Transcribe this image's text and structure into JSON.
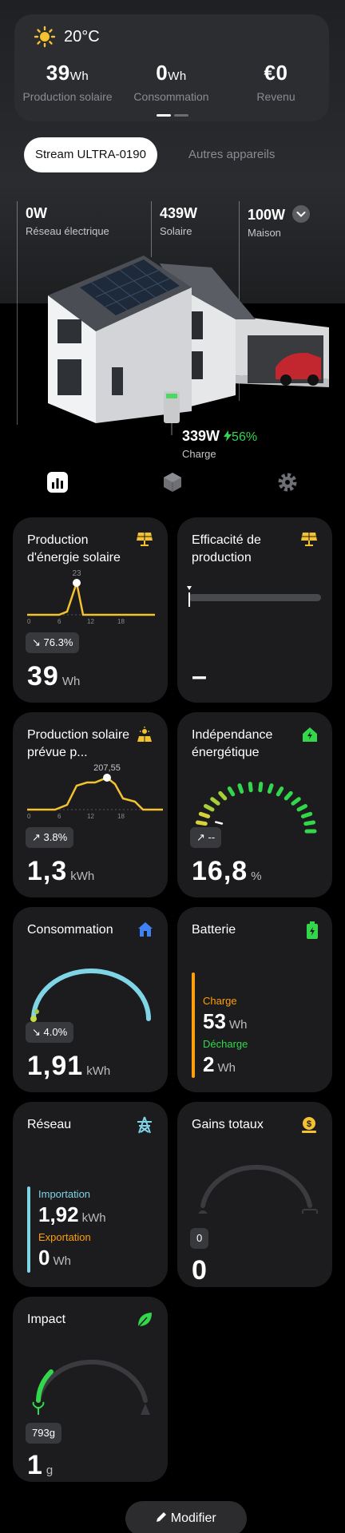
{
  "colors": {
    "accent_yellow": "#f2c230",
    "accent_green": "#32d74b",
    "accent_cyan": "#7fd4e6",
    "accent_orange": "#ff9f0a",
    "accent_blue": "#3f82f5",
    "card_bg": "#1c1c1e"
  },
  "summary": {
    "temperature": "20°C",
    "weather_icon": "sun-icon",
    "stats": [
      {
        "value": "39",
        "unit": "Wh",
        "label": "Production solaire"
      },
      {
        "value": "0",
        "unit": "Wh",
        "label": "Consommation"
      },
      {
        "value": "€0",
        "unit": "",
        "label": "Revenu"
      }
    ]
  },
  "device_tabs": {
    "active": "Stream ULTRA-0190",
    "other": "Autres appareils"
  },
  "flows": {
    "grid": {
      "value": "0W",
      "label": "Réseau électrique"
    },
    "solar": {
      "value": "439W",
      "label": "Solaire"
    },
    "home": {
      "value": "100W",
      "label": "Maison"
    },
    "battery": {
      "value": "339W",
      "percent": "56%",
      "label": "Charge"
    }
  },
  "view_tabs": [
    "chart-icon",
    "cube-icon",
    "gear-icon"
  ],
  "cards": {
    "solar_production": {
      "title": "Production d'énergie solaire",
      "peak_label": "23",
      "ticks": [
        "0",
        "6",
        "12",
        "18"
      ],
      "change": "76.3%",
      "value": "39",
      "unit": "Wh"
    },
    "efficiency": {
      "title": "Efficacité de production",
      "value": "–"
    },
    "forecast": {
      "title": "Production solaire prévue p...",
      "peak_label": "207,55",
      "ticks": [
        "0",
        "6",
        "12",
        "18"
      ],
      "change": "3.8%",
      "value": "1,3",
      "unit": "kWh"
    },
    "independence": {
      "title": "Indépendance énergétique",
      "change": "--",
      "value": "16,8",
      "unit": "%",
      "level_percent": 16.8
    },
    "consumption": {
      "title": "Consommation",
      "change": "4.0%",
      "value": "1,91",
      "unit": "kWh"
    },
    "battery": {
      "title": "Batterie",
      "charge_label": "Charge",
      "charge_value": "53",
      "charge_unit": "Wh",
      "discharge_label": "Décharge",
      "discharge_value": "2",
      "discharge_unit": "Wh"
    },
    "grid": {
      "title": "Réseau",
      "import_label": "Importation",
      "import_value": "1,92",
      "import_unit": "kWh",
      "export_label": "Exportation",
      "export_value": "0",
      "export_unit": "Wh"
    },
    "earnings": {
      "title": "Gains totaux",
      "pill": "0",
      "value": "0"
    },
    "impact": {
      "title": "Impact",
      "pill": "793g",
      "value": "1",
      "unit": "g"
    }
  },
  "modifier_label": "Modifier"
}
